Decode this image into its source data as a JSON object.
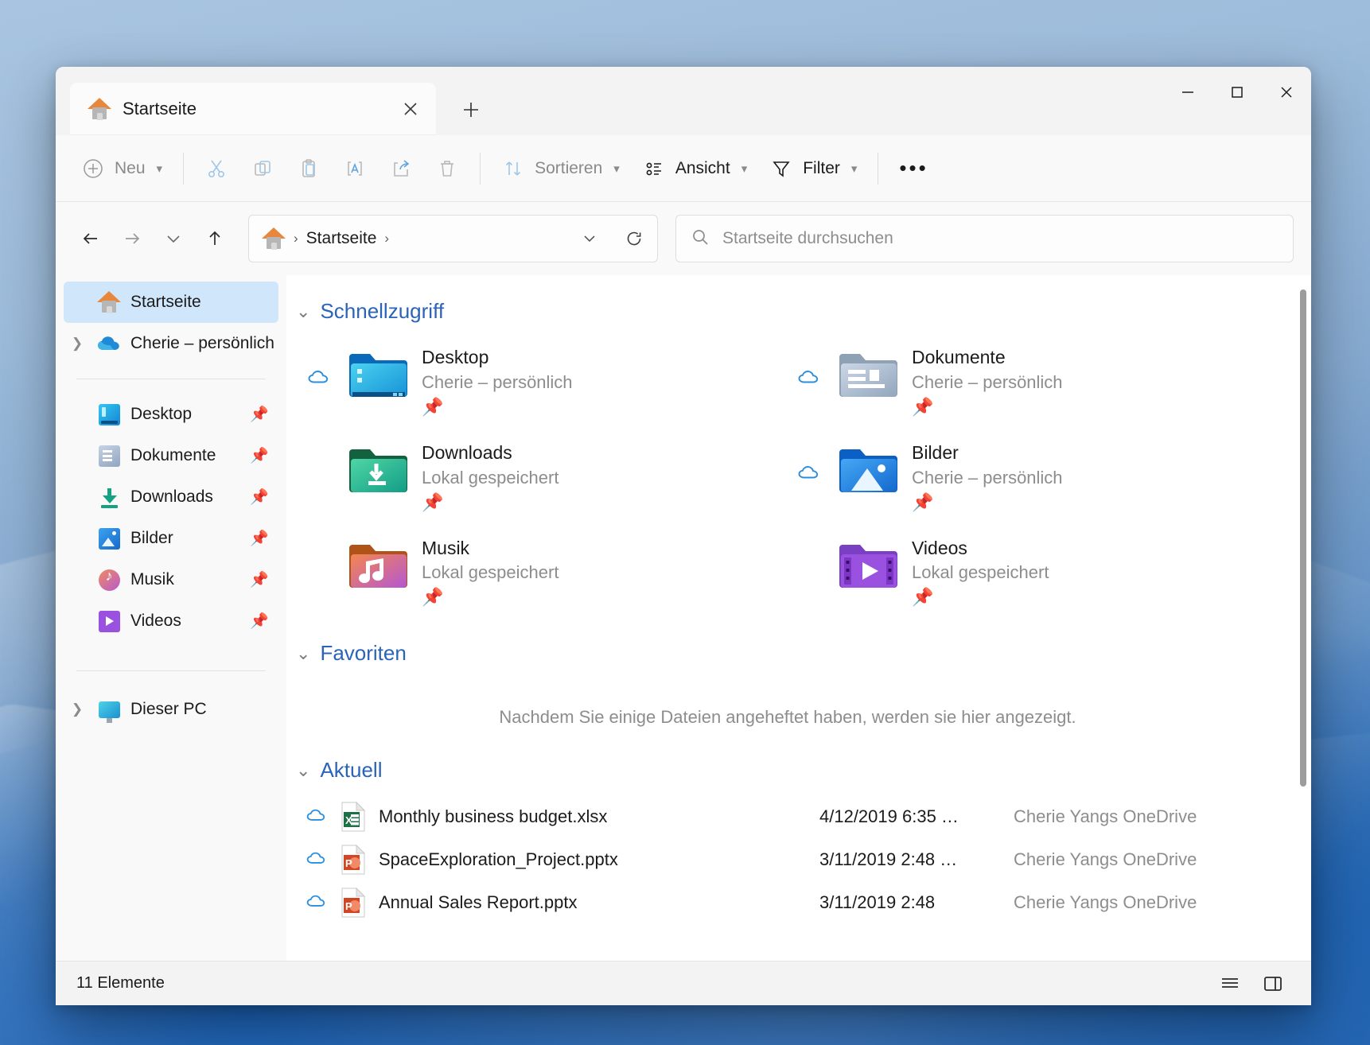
{
  "window": {
    "tab_title": "Startseite",
    "tab_close_icon": "close-icon",
    "new_tab_icon": "plus-icon",
    "minimize_icon": "minimize-icon",
    "maximize_icon": "maximize-icon",
    "close_icon": "close-icon"
  },
  "toolbar": {
    "new_label": "Neu",
    "cut_icon": "scissors-icon",
    "copy_icon": "copy-icon",
    "paste_icon": "paste-icon",
    "rename_icon": "rename-icon",
    "share_icon": "share-icon",
    "delete_icon": "trash-icon",
    "sort_label": "Sortieren",
    "view_label": "Ansicht",
    "filter_label": "Filter",
    "more_label": "•••"
  },
  "navbar": {
    "back_icon": "arrow-left-icon",
    "forward_icon": "arrow-right-icon",
    "recent_icon": "chevron-down-icon",
    "up_icon": "arrow-up-icon",
    "breadcrumb_home_icon": "home-icon",
    "breadcrumb": "Startseite",
    "crumb_sep": "›",
    "dropdown_icon": "chevron-down-icon",
    "refresh_icon": "refresh-icon",
    "search_icon": "search-icon",
    "search_placeholder": "Startseite durchsuchen",
    "search_value": ""
  },
  "sidebar": {
    "items": [
      {
        "label": "Startseite",
        "icon": "home-icon",
        "selected": true,
        "expandable": false,
        "pinned": false
      },
      {
        "label": "Cherie – persönlich",
        "icon": "onedrive-cloud-icon",
        "selected": false,
        "expandable": true,
        "pinned": false
      }
    ],
    "pinned_items": [
      {
        "label": "Desktop",
        "icon": "desktop-icon",
        "pinned": true
      },
      {
        "label": "Dokumente",
        "icon": "documents-icon",
        "pinned": true
      },
      {
        "label": "Downloads",
        "icon": "downloads-icon",
        "pinned": true
      },
      {
        "label": "Bilder",
        "icon": "pictures-icon",
        "pinned": true
      },
      {
        "label": "Musik",
        "icon": "music-icon",
        "pinned": true
      },
      {
        "label": "Videos",
        "icon": "videos-icon",
        "pinned": true
      }
    ],
    "bottom_items": [
      {
        "label": "Dieser PC",
        "icon": "this-pc-icon",
        "expandable": true
      }
    ],
    "pin_icon": "pin-icon",
    "expand_icon": "chevron-right-icon"
  },
  "main": {
    "sections": {
      "quick_access": {
        "title": "Schnellzugriff",
        "chevron_icon": "chevron-down-icon",
        "tiles": [
          {
            "name": "Desktop",
            "subtitle": "Cherie – persönlich",
            "folder": "desktop",
            "cloud": true,
            "pinned": true
          },
          {
            "name": "Dokumente",
            "subtitle": "Cherie – persönlich",
            "folder": "documents",
            "cloud": true,
            "pinned": true
          },
          {
            "name": "Downloads",
            "subtitle": "Lokal gespeichert",
            "folder": "downloads",
            "cloud": false,
            "pinned": true
          },
          {
            "name": "Bilder",
            "subtitle": "Cherie – persönlich",
            "folder": "pictures",
            "cloud": true,
            "pinned": true
          },
          {
            "name": "Musik",
            "subtitle": "Lokal gespeichert",
            "folder": "music",
            "cloud": false,
            "pinned": true
          },
          {
            "name": "Videos",
            "subtitle": "Lokal gespeichert",
            "folder": "videos",
            "cloud": false,
            "pinned": true
          }
        ]
      },
      "favorites": {
        "title": "Favoriten",
        "chevron_icon": "chevron-down-icon",
        "empty_message": "Nachdem Sie einige Dateien angeheftet haben, werden sie hier angezeigt."
      },
      "recent": {
        "title": "Aktuell",
        "chevron_icon": "chevron-down-icon",
        "rows": [
          {
            "name": "Monthly business budget.xlsx",
            "date": "4/12/2019 6:35 …",
            "location": "Cherie Yangs OneDrive",
            "type": "excel",
            "cloud": true
          },
          {
            "name": "SpaceExploration_Project.pptx",
            "date": "3/11/2019 2:48 …",
            "location": "Cherie Yangs OneDrive",
            "type": "powerpoint",
            "cloud": true
          },
          {
            "name": "Annual Sales Report.pptx",
            "date": "3/11/2019 2:48",
            "location": "Cherie Yangs OneDrive",
            "type": "powerpoint",
            "cloud": true
          }
        ]
      }
    }
  },
  "statusbar": {
    "item_count": "11 Elemente",
    "details_view_icon": "list-view-icon",
    "pane_view_icon": "details-pane-icon"
  },
  "colors": {
    "accent": "#2a64b8",
    "selection": "#cfe6fb",
    "muted_text": "#8d8d8d",
    "window_bg": "#f3f3f3"
  }
}
